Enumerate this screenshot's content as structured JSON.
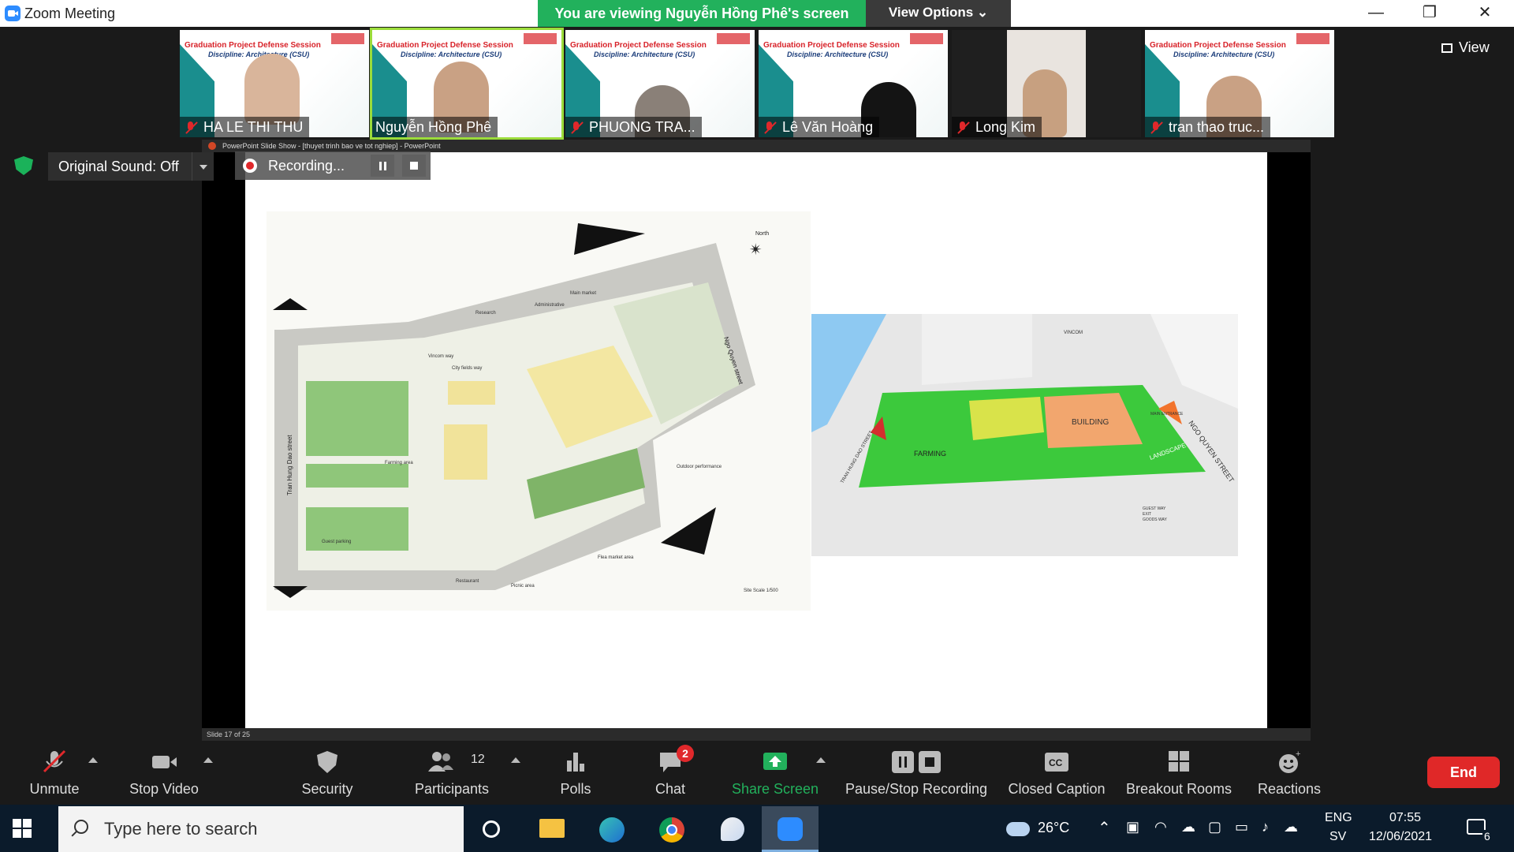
{
  "window": {
    "title": "Zoom Meeting",
    "viewing_banner": "You are viewing Nguyễn Hồng Phê's screen",
    "view_options": "View Options ⌄",
    "controls": [
      "—",
      "❐",
      "✕"
    ]
  },
  "gallery": {
    "view_label": "View",
    "slide_heading": "Graduation Project Defense Session",
    "slide_sub": "Discipline: Architecture (CSU)",
    "participants": [
      {
        "name": "HA LE THI THU",
        "muted": true
      },
      {
        "name": "Nguyễn Hồng Phê",
        "muted": false
      },
      {
        "name": "PHUONG TRA...",
        "muted": true
      },
      {
        "name": "Lê Văn Hoàng",
        "muted": true
      },
      {
        "name": "Long Kim",
        "muted": true
      },
      {
        "name": "tran thao truc...",
        "muted": true
      }
    ]
  },
  "share": {
    "original_sound": "Original Sound: Off",
    "recording_label": "Recording...",
    "ppt_title": "PowerPoint Slide Show - [thuyet trinh bao ve tot nghiep] - PowerPoint",
    "slide_counter": "Slide 17 of 25",
    "plan_left": {
      "north": "North",
      "street_left": "Tran Hung Dao street",
      "street_right": "Ngo Quyen street",
      "labels": [
        "Main market",
        "Administrative",
        "Research",
        "Vincom way",
        "City fields way",
        "Farming area",
        "Guest parking",
        "Restaurant",
        "Picnic area",
        "Flea market area",
        "Outdoor performance",
        "Site Scale 1/500"
      ]
    },
    "plan_right": {
      "labels": [
        "BUILDING",
        "FARMING",
        "LANDSCAPE",
        "NGO QUYEN STREET",
        "TRAN HUNG DAO STREET",
        "MAIN ENTRANCE",
        "VINCOM"
      ],
      "legend": [
        "GUEST WAY",
        "EXIT",
        "GOODS WAY"
      ]
    }
  },
  "toolbar": {
    "unmute": "Unmute",
    "stop_video": "Stop Video",
    "security": "Security",
    "participants": "Participants",
    "participants_count": "12",
    "polls": "Polls",
    "chat": "Chat",
    "chat_badge": "2",
    "share_screen": "Share Screen",
    "pause_stop_recording": "Pause/Stop Recording",
    "closed_caption": "Closed Caption",
    "breakout_rooms": "Breakout Rooms",
    "reactions": "Reactions",
    "end": "End",
    "share_color": "#22b15c",
    "end_color": "#e02828"
  },
  "taskbar": {
    "search_placeholder": "Type here to search",
    "weather": "26°C",
    "lang_top": "ENG",
    "lang_bottom": "SV",
    "time": "07:55",
    "date": "12/06/2021",
    "notifications": "6"
  }
}
